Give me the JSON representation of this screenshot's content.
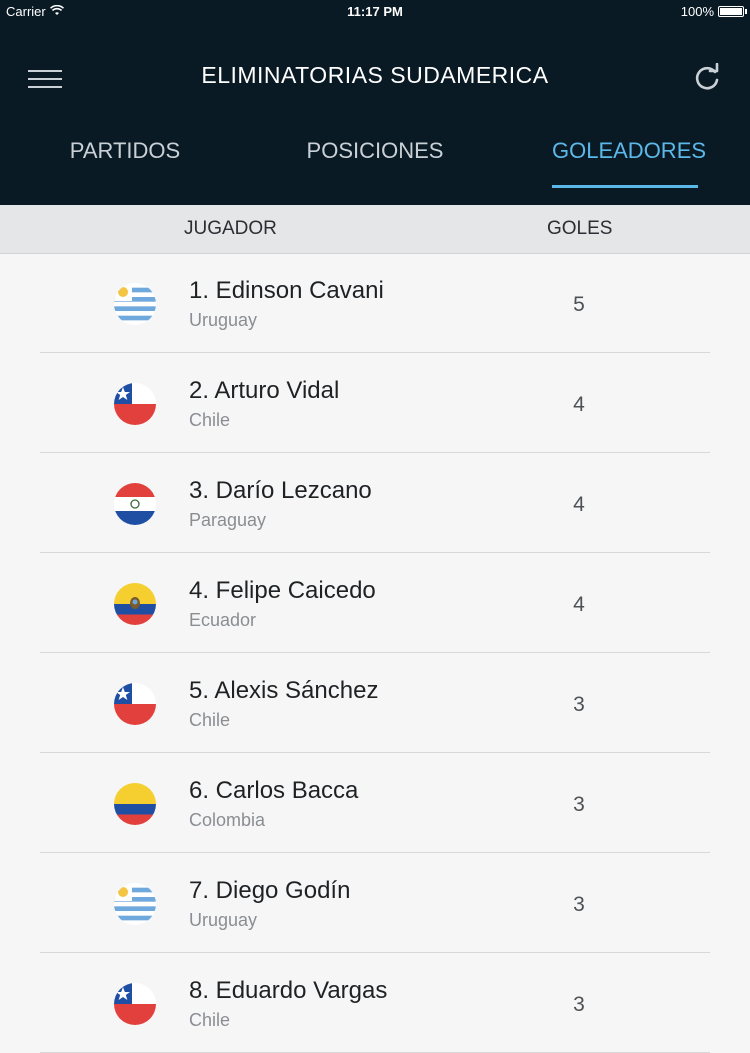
{
  "status_bar": {
    "carrier": "Carrier",
    "time": "11:17 PM",
    "battery": "100%"
  },
  "header": {
    "title": "ELIMINATORIAS SUDAMERICA",
    "menu_icon": "hamburger-icon",
    "refresh_icon": "refresh-icon"
  },
  "tabs": [
    {
      "label": "PARTIDOS",
      "active": false
    },
    {
      "label": "POSICIONES",
      "active": false
    },
    {
      "label": "GOLEADORES",
      "active": true
    }
  ],
  "table": {
    "columns": [
      "JUGADOR",
      "GOLES"
    ],
    "rows": [
      {
        "name": "1. Edinson Cavani",
        "country": "Uruguay",
        "goals": "5",
        "flag": "uruguay"
      },
      {
        "name": "2. Arturo Vidal",
        "country": "Chile",
        "goals": "4",
        "flag": "chile"
      },
      {
        "name": "3. Darío Lezcano",
        "country": "Paraguay",
        "goals": "4",
        "flag": "paraguay"
      },
      {
        "name": "4. Felipe Caicedo",
        "country": "Ecuador",
        "goals": "4",
        "flag": "ecuador"
      },
      {
        "name": "5. Alexis Sánchez",
        "country": "Chile",
        "goals": "3",
        "flag": "chile"
      },
      {
        "name": "6. Carlos Bacca",
        "country": "Colombia",
        "goals": "3",
        "flag": "colombia"
      },
      {
        "name": "7. Diego Godín",
        "country": "Uruguay",
        "goals": "3",
        "flag": "uruguay"
      },
      {
        "name": "8. Eduardo Vargas",
        "country": "Chile",
        "goals": "3",
        "flag": "chile"
      }
    ]
  },
  "colors": {
    "bar": "#0a1a25",
    "accent": "#5bb8e8",
    "header_bg": "#e4e6e8"
  }
}
